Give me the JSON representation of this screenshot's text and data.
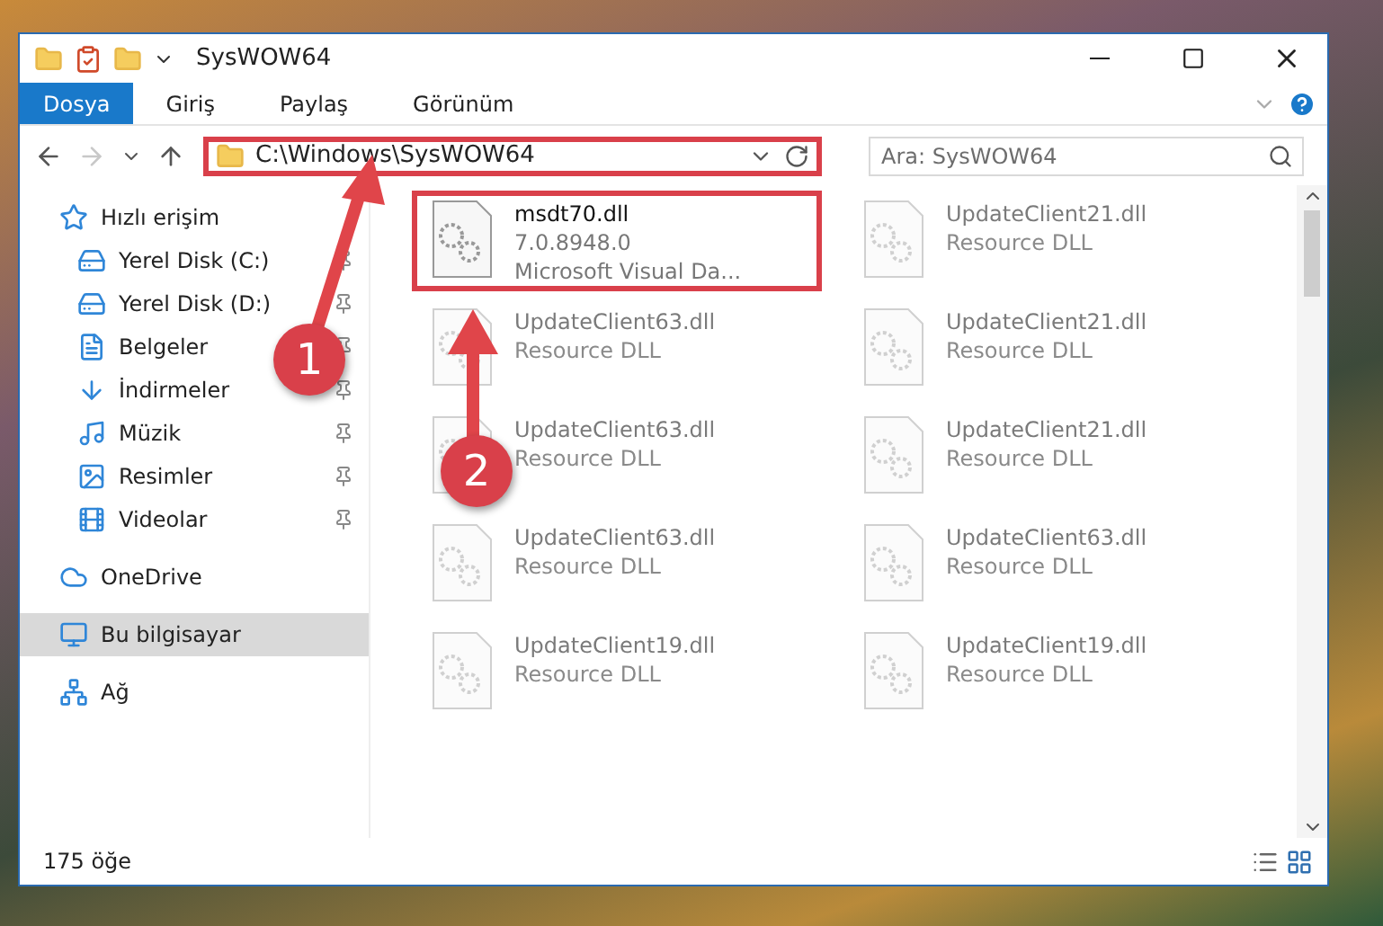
{
  "window": {
    "title": "SysWOW64"
  },
  "ribbon": {
    "tabs": [
      {
        "label": "Dosya",
        "kind": "file"
      },
      {
        "label": "Giriş",
        "kind": "tab"
      },
      {
        "label": "Paylaş",
        "kind": "tab"
      },
      {
        "label": "Görünüm",
        "kind": "tab"
      }
    ]
  },
  "navigation": {
    "back": {
      "disabled": false
    },
    "forward": {
      "disabled": true
    }
  },
  "address_bar": {
    "path": "C:\\Windows\\SysWOW64",
    "highlighted": true
  },
  "search": {
    "placeholder": "Ara: SysWOW64"
  },
  "sidebar": {
    "items": [
      {
        "label": "Hızlı erişim",
        "kind": "star",
        "selected": false,
        "children": [
          {
            "label": "Yerel Disk (C:)",
            "kind": "drive",
            "pinned": true,
            "selected": false
          },
          {
            "label": "Yerel Disk (D:)",
            "kind": "drive",
            "pinned": true,
            "selected": false
          },
          {
            "label": "Belgeler",
            "kind": "docs",
            "pinned": true,
            "selected": false
          },
          {
            "label": "İndirmeler",
            "kind": "download",
            "pinned": true,
            "selected": false
          },
          {
            "label": "Müzik",
            "kind": "music",
            "pinned": true,
            "selected": false
          },
          {
            "label": "Resimler",
            "kind": "pictures",
            "pinned": true,
            "selected": false
          },
          {
            "label": "Videolar",
            "kind": "video",
            "pinned": true,
            "selected": false
          }
        ]
      },
      {
        "label": "OneDrive",
        "kind": "cloud",
        "selected": false
      },
      {
        "label": "Bu bilgisayar",
        "kind": "pc",
        "selected": true
      },
      {
        "label": "Ağ",
        "kind": "network",
        "selected": false
      }
    ]
  },
  "files": [
    {
      "name": "msdt70.dll",
      "details": [
        "7.0.8948.0",
        "Microsoft Visual Da..."
      ],
      "highlighted": true,
      "blurred": false
    },
    {
      "name": "UpdateClient21.dll",
      "details": [
        "Resource DLL"
      ],
      "highlighted": false,
      "blurred": true
    },
    {
      "name": "UpdateClient63.dll",
      "details": [
        "Resource DLL"
      ],
      "highlighted": false,
      "blurred": true
    },
    {
      "name": "UpdateClient21.dll",
      "details": [
        "Resource DLL"
      ],
      "highlighted": false,
      "blurred": true
    },
    {
      "name": "UpdateClient63.dll",
      "details": [
        "Resource DLL"
      ],
      "highlighted": false,
      "blurred": true
    },
    {
      "name": "UpdateClient21.dll",
      "details": [
        "Resource DLL"
      ],
      "highlighted": false,
      "blurred": true
    },
    {
      "name": "UpdateClient63.dll",
      "details": [
        "Resource DLL"
      ],
      "highlighted": false,
      "blurred": true
    },
    {
      "name": "UpdateClient63.dll",
      "details": [
        "Resource DLL"
      ],
      "highlighted": false,
      "blurred": true
    },
    {
      "name": "UpdateClient19.dll",
      "details": [
        "Resource DLL"
      ],
      "highlighted": false,
      "blurred": true
    },
    {
      "name": "UpdateClient19.dll",
      "details": [
        "Resource DLL"
      ],
      "highlighted": false,
      "blurred": true
    }
  ],
  "status_bar": {
    "count": "175 öğe"
  },
  "annotations": [
    {
      "number": "1"
    },
    {
      "number": "2"
    }
  ]
}
